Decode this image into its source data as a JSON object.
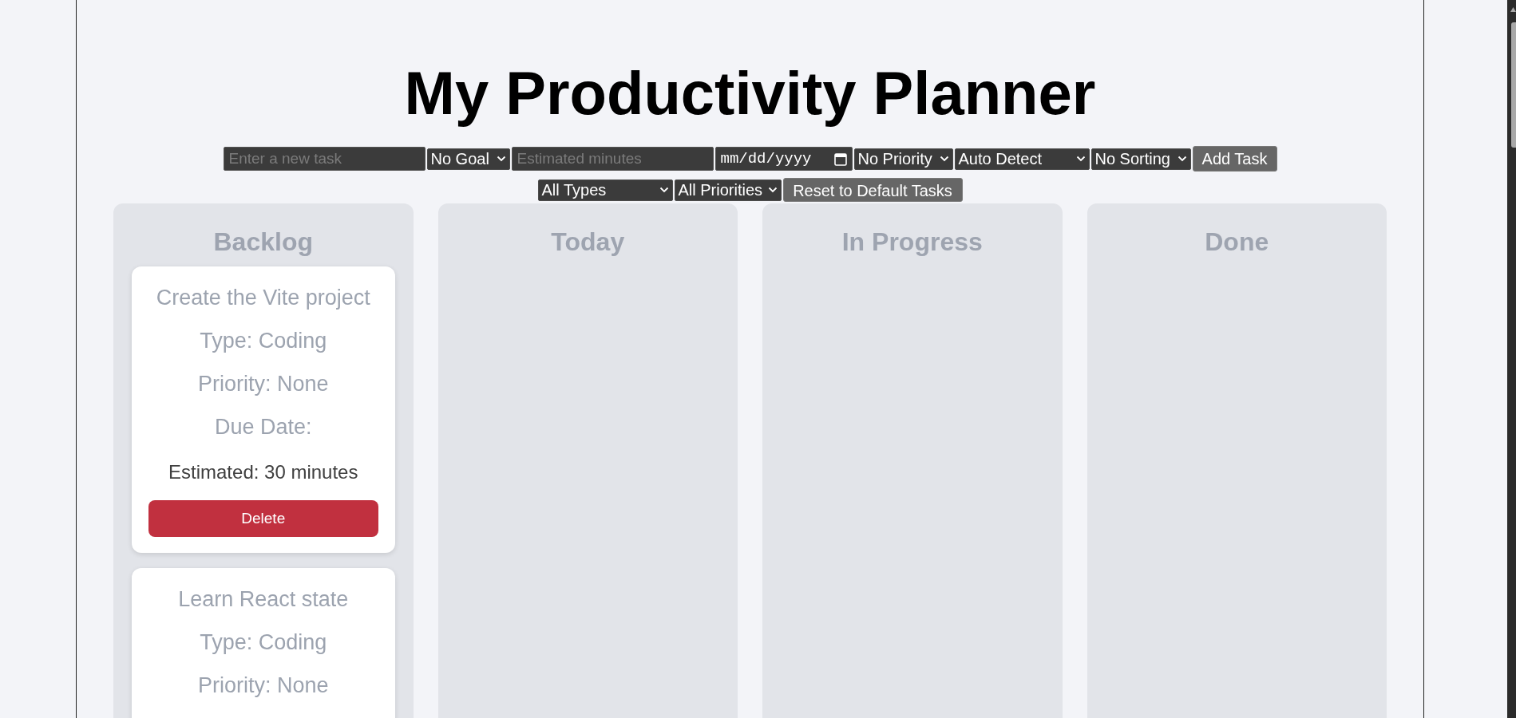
{
  "title": "My Productivity Planner",
  "add_task_form": {
    "task_name": {
      "placeholder": "Enter a new task"
    },
    "goal": {
      "value": "No Goal"
    },
    "estimated_minutes": {
      "placeholder": "Estimated minutes"
    },
    "due_date": {
      "placeholder": "mm/dd/yyyy"
    },
    "priority": {
      "value": "No Priority"
    },
    "type": {
      "value": "Auto Detect"
    },
    "sorting": {
      "value": "No Sorting"
    },
    "submit_button": "Add Task"
  },
  "filters": {
    "type": {
      "value": "All Types"
    },
    "priority": {
      "value": "All Priorities"
    },
    "reset_button": "Reset to Default Tasks"
  },
  "columns": [
    {
      "title": "Backlog",
      "cards": [
        {
          "title": "Create the Vite project",
          "type": "Type: Coding",
          "priority": "Priority: None",
          "due_date": "Due Date:",
          "estimated": "Estimated: 30 minutes",
          "delete_button": "Delete"
        },
        {
          "title": "Learn React state",
          "type": "Type: Coding",
          "priority": "Priority: None"
        }
      ]
    },
    {
      "title": "Today"
    },
    {
      "title": "In Progress"
    },
    {
      "title": "Done"
    }
  ]
}
